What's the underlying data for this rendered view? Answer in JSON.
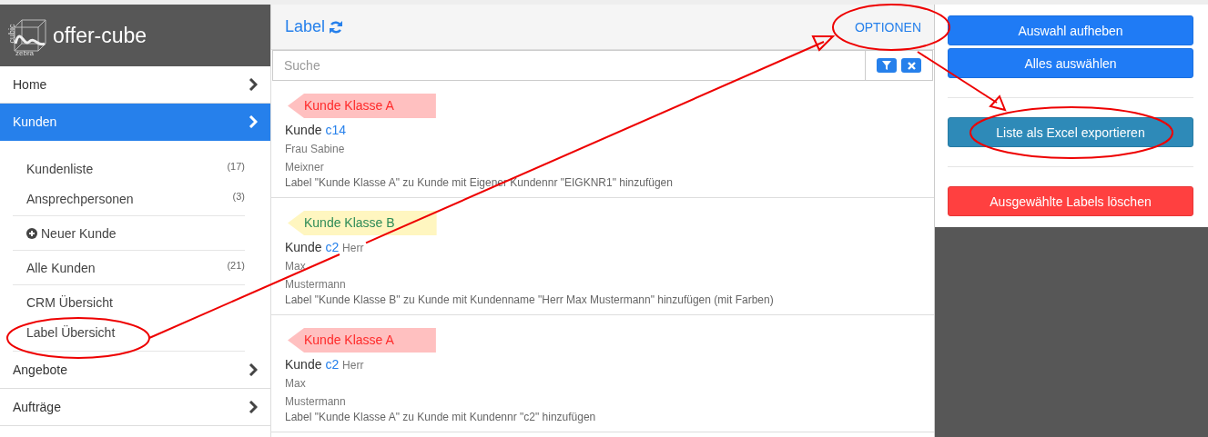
{
  "sidebar": {
    "logo": {
      "top": "cubic",
      "bottom": "zebra"
    },
    "brand": "offer-cube",
    "items": [
      {
        "label": "Home",
        "selected": false
      },
      {
        "label": "Kunden",
        "selected": true,
        "groups": [
          [
            {
              "label": "Kundenliste",
              "count": "(17)",
              "kind": "link"
            },
            {
              "label": "Ansprechpersonen",
              "count": "(3)",
              "kind": "link"
            }
          ],
          [
            {
              "label": "Neuer Kunde",
              "kind": "add"
            }
          ],
          [
            {
              "label": "Alle Kunden",
              "count": "(21)",
              "kind": "link"
            }
          ],
          [
            {
              "label": "CRM Übersicht",
              "kind": "link"
            },
            {
              "label": "Label Übersicht",
              "kind": "link"
            }
          ]
        ]
      },
      {
        "label": "Angebote",
        "selected": false
      },
      {
        "label": "Aufträge",
        "selected": false
      }
    ]
  },
  "panel": {
    "title": "Label",
    "options": "OPTIONEN",
    "search": {
      "placeholder": "Suche"
    },
    "cards": [
      {
        "tag": {
          "text": "Kunde Klasse A",
          "color": "#ff2a2a",
          "kind": "alert"
        },
        "title": "Kunde",
        "code": "c14",
        "lines": [
          "Frau Sabine",
          "Meixner"
        ],
        "description": "Label \"Kunde Klasse A\" zu Kunde mit Eigener Kundennr \"EIGKNR1\" hinzufügen"
      },
      {
        "tag": {
          "text": "Kunde Klasse B",
          "color": "#2e8b57",
          "kind": "notice"
        },
        "title": "Kunde",
        "code": "c2",
        "salutation": "Herr",
        "lines": [
          "Max",
          "Mustermann"
        ],
        "description": "Label \"Kunde Klasse B\" zu Kunde mit Kundenname \"Herr Max Mustermann\" hinzufügen (mit Farben)"
      },
      {
        "tag": {
          "text": "Kunde Klasse A",
          "color": "#ff2a2a",
          "kind": "alert"
        },
        "title": "Kunde",
        "code": "c2",
        "salutation": "Herr",
        "lines": [
          "Max",
          "Mustermann"
        ],
        "description": "Label \"Kunde Klasse A\" zu Kunde mit Kundennr \"c2\" hinzufügen"
      }
    ]
  },
  "actions": [
    [
      {
        "label": "Auswahl aufheben",
        "kind": "primary"
      },
      {
        "label": "Alles auswählen",
        "kind": "primary"
      }
    ],
    [
      {
        "label": "Liste als Excel exportieren",
        "kind": "info"
      }
    ],
    [
      {
        "label": "Ausgewählte Labels löschen",
        "kind": "danger"
      }
    ]
  ]
}
